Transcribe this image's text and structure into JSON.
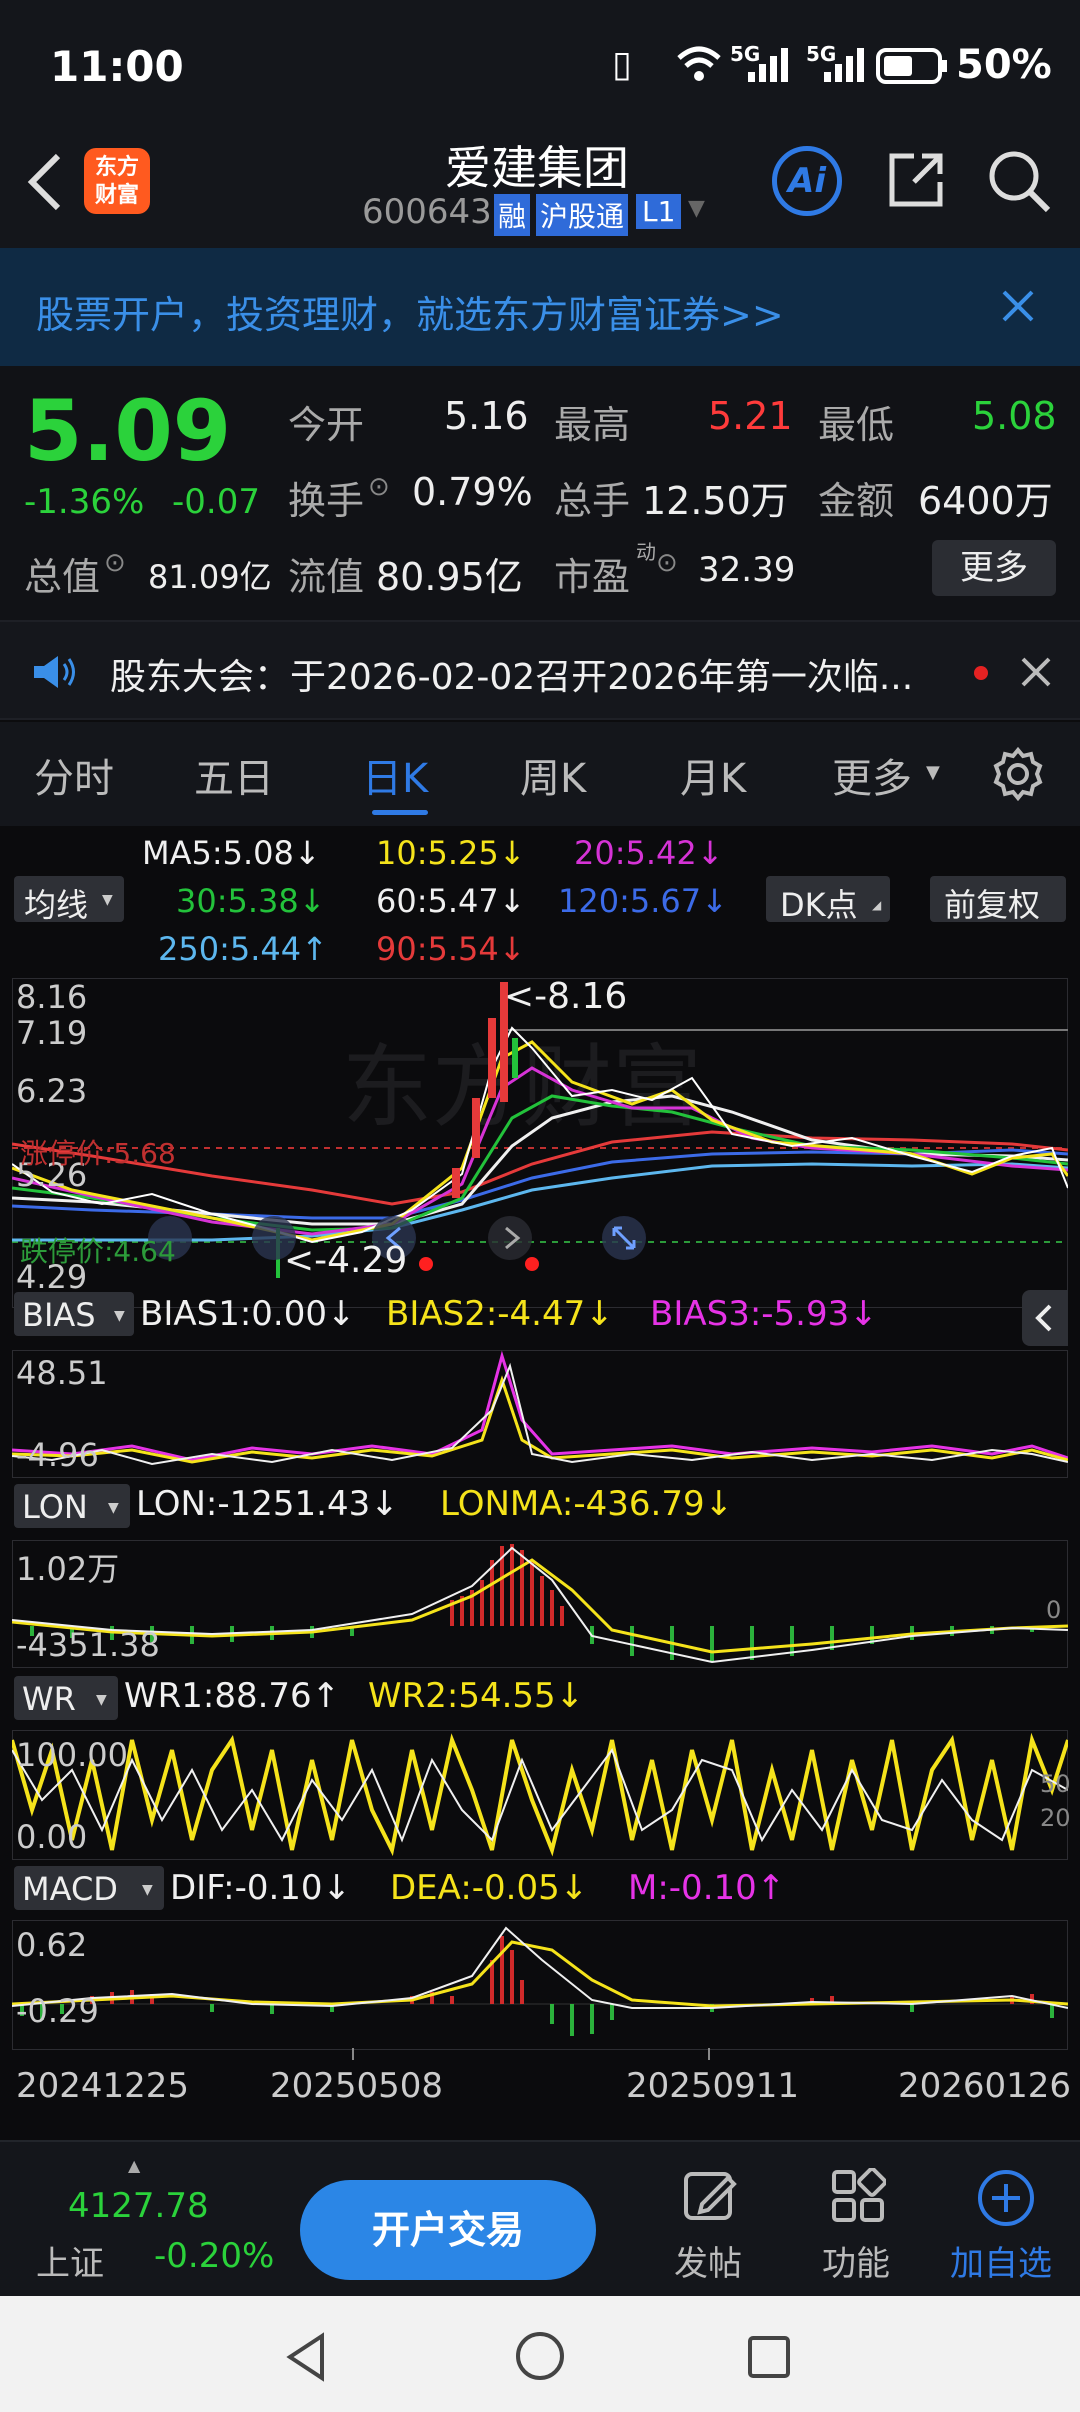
{
  "status": {
    "time": "11:00",
    "network_a": "5G",
    "network_b": "5G",
    "battery": "50%"
  },
  "header": {
    "app_logo_text": "东方财富",
    "stock_name": "爱建集团",
    "stock_code": "600643",
    "badge_margin": "融",
    "badge_connect": "沪股通",
    "badge_level": "L1",
    "ai_label": "Ai"
  },
  "banner": {
    "text": "股票开户，投资理财，就选东方财富证券>>"
  },
  "quote": {
    "price": "5.09",
    "change_pct": "-1.36%",
    "change": "-0.07",
    "open_label": "今开",
    "open": "5.16",
    "high_label": "最高",
    "high": "5.21",
    "low_label": "最低",
    "low": "5.08",
    "turnover_label": "换手",
    "turnover": "0.79%",
    "volume_label": "总手",
    "volume": "12.50万",
    "amount_label": "金额",
    "amount": "6400万",
    "mktcap_label": "总值",
    "mktcap": "81.09亿",
    "float_label": "流值",
    "float": "80.95亿",
    "pe_label": "市盈",
    "pe_sup": "动",
    "pe": "32.39",
    "more_button": "更多",
    "colors": {
      "up": "#ff3b3b",
      "down": "#2bd23b",
      "price": "#2bd23b"
    }
  },
  "notice": {
    "text": "股东大会：于2026-02-02召开2026年第一次临..."
  },
  "tabs": {
    "items": [
      "分时",
      "五日",
      "日K",
      "周K",
      "月K",
      "更多"
    ],
    "active": "日K"
  },
  "ma": {
    "selector": "均线",
    "ma5": "MA5:5.08↓",
    "ma10": "10:5.25↓",
    "ma20": "20:5.42↓",
    "ma30": "30:5.38↓",
    "ma60": "60:5.47↓",
    "ma120": "120:5.67↓",
    "ma250": "250:5.44↑",
    "ma90": "90:5.54↓",
    "dk_button": "DK点",
    "adjust_button": "前复权"
  },
  "kline": {
    "y_labels": [
      "8.16",
      "7.19",
      "6.23",
      "5.26",
      "4.29"
    ],
    "limit_up": "涨停价:5.68",
    "limit_down": "跌停价:4.64",
    "max_marker": "<-8.16",
    "min_marker": "<-4.29",
    "watermark": "东方财富"
  },
  "bias": {
    "selector": "BIAS",
    "b1": "BIAS1:0.00↓",
    "b2": "BIAS2:-4.47↓",
    "b3": "BIAS3:-5.93↓",
    "y_top": "48.51",
    "y_bottom": "-4.96"
  },
  "lon": {
    "selector": "LON",
    "lon": "LON:-1251.43↓",
    "lonma": "LONMA:-436.79↓",
    "y_top": "1.02万",
    "y_bottom": "-4351.38",
    "y_zero": "0"
  },
  "wr": {
    "selector": "WR",
    "wr1": "WR1:88.76↑",
    "wr2": "WR2:54.55↓",
    "y_top": "100.00",
    "y_bottom": "0.00",
    "right_top": "50",
    "right_bottom": "20"
  },
  "macd": {
    "selector": "MACD",
    "dif": "DIF:-0.10↓",
    "dea": "DEA:-0.05↓",
    "m": "M:-0.10↑",
    "y_top": "0.62",
    "y_bottom": "-0.29"
  },
  "x_axis": {
    "labels": [
      "20241225",
      "20250508",
      "20250911",
      "20260126"
    ]
  },
  "bottom": {
    "index_value": "4127.78",
    "index_name": "上证",
    "index_change": "-0.20%",
    "trade_button": "开户交易",
    "post": "发帖",
    "functions": "功能",
    "add_watch": "加自选"
  }
}
